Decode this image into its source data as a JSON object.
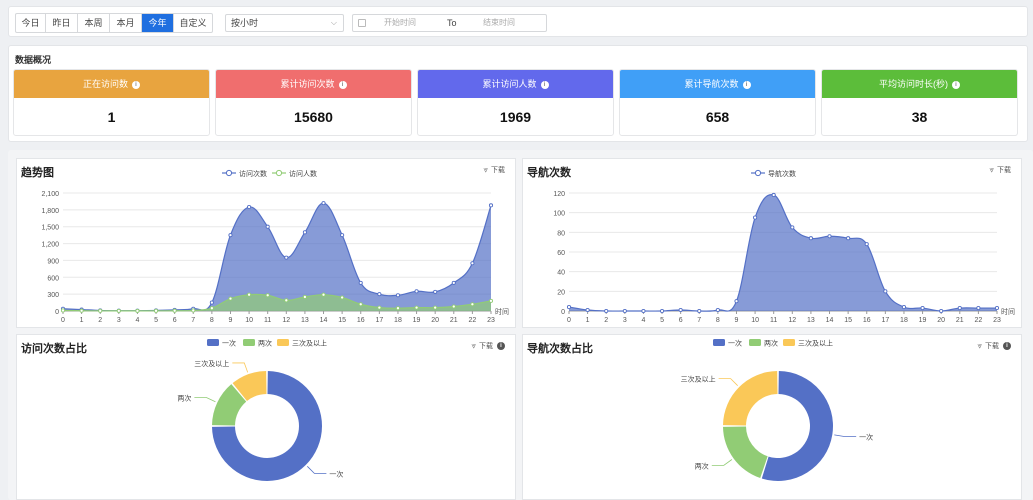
{
  "toolbar": {
    "tabs": [
      "今日",
      "昨日",
      "本周",
      "本月",
      "今年",
      "自定义"
    ],
    "active_tab": "今年",
    "granularity": "按小时",
    "start_placeholder": "开始时间",
    "to_label": "To",
    "end_placeholder": "结束时间"
  },
  "overview": {
    "title": "数据概况",
    "cards": [
      {
        "label": "正在访问数",
        "value": "1",
        "color": "#e8a43f"
      },
      {
        "label": "累计访问次数",
        "value": "15680",
        "color": "#f06e6e"
      },
      {
        "label": "累计访问人数",
        "value": "1969",
        "color": "#6269ec"
      },
      {
        "label": "累计导航次数",
        "value": "658",
        "color": "#409ff7"
      },
      {
        "label": "平均访问时长(秒)",
        "value": "38",
        "color": "#5cbd3a"
      }
    ]
  },
  "download_label": "下载",
  "trend": {
    "title": "趋势图",
    "legend": [
      "访问次数",
      "访问人数"
    ],
    "xlabel": "时间"
  },
  "nav": {
    "title": "导航次数",
    "legend": [
      "导航次数"
    ],
    "xlabel": "时间"
  },
  "visit_ratio": {
    "title": "访问次数占比",
    "legend": [
      "一次",
      "两次",
      "三次及以上"
    ]
  },
  "nav_ratio": {
    "title": "导航次数占比",
    "legend": [
      "一次",
      "两次",
      "三次及以上"
    ]
  },
  "chart_data": [
    {
      "type": "area",
      "title": "趋势图",
      "xlabel": "时间",
      "x": [
        0,
        1,
        2,
        3,
        4,
        5,
        6,
        7,
        8,
        9,
        10,
        11,
        12,
        13,
        14,
        15,
        16,
        17,
        18,
        19,
        20,
        21,
        22,
        23
      ],
      "ylim": [
        0,
        2100
      ],
      "yticks": [
        "0",
        "300",
        "600",
        "900",
        "1,200",
        "1,500",
        "1,800",
        "2,100"
      ],
      "series": [
        {
          "name": "访问次数",
          "color": "#5470c6",
          "values": [
            40,
            25,
            10,
            5,
            5,
            10,
            20,
            40,
            150,
            1350,
            1850,
            1500,
            950,
            1400,
            1920,
            1350,
            500,
            300,
            280,
            350,
            340,
            500,
            850,
            1880
          ]
        },
        {
          "name": "访问人数",
          "color": "#91cc75",
          "values": [
            10,
            5,
            3,
            2,
            2,
            3,
            5,
            10,
            50,
            220,
            290,
            280,
            190,
            250,
            290,
            240,
            120,
            60,
            50,
            60,
            60,
            80,
            120,
            180
          ]
        }
      ]
    },
    {
      "type": "area",
      "title": "导航次数",
      "xlabel": "时间",
      "x": [
        0,
        1,
        2,
        3,
        4,
        5,
        6,
        7,
        8,
        9,
        10,
        11,
        12,
        13,
        14,
        15,
        16,
        17,
        18,
        19,
        20,
        21,
        22,
        23
      ],
      "ylim": [
        0,
        120
      ],
      "yticks": [
        "0",
        "20",
        "40",
        "60",
        "80",
        "100",
        "120"
      ],
      "series": [
        {
          "name": "导航次数",
          "color": "#5470c6",
          "values": [
            4,
            1,
            0,
            0,
            0,
            0,
            1,
            0,
            1,
            10,
            95,
            118,
            85,
            74,
            76,
            74,
            68,
            20,
            4,
            3,
            0,
            3,
            3,
            3,
            15
          ]
        }
      ]
    },
    {
      "type": "pie",
      "title": "访问次数占比",
      "categories": [
        "一次",
        "两次",
        "三次及以上"
      ],
      "values": [
        75,
        14,
        11
      ],
      "colors": [
        "#5470c6",
        "#91cc75",
        "#fac858"
      ]
    },
    {
      "type": "pie",
      "title": "导航次数占比",
      "categories": [
        "一次",
        "两次",
        "三次及以上"
      ],
      "values": [
        55,
        20,
        25
      ],
      "colors": [
        "#5470c6",
        "#91cc75",
        "#fac858"
      ]
    }
  ]
}
